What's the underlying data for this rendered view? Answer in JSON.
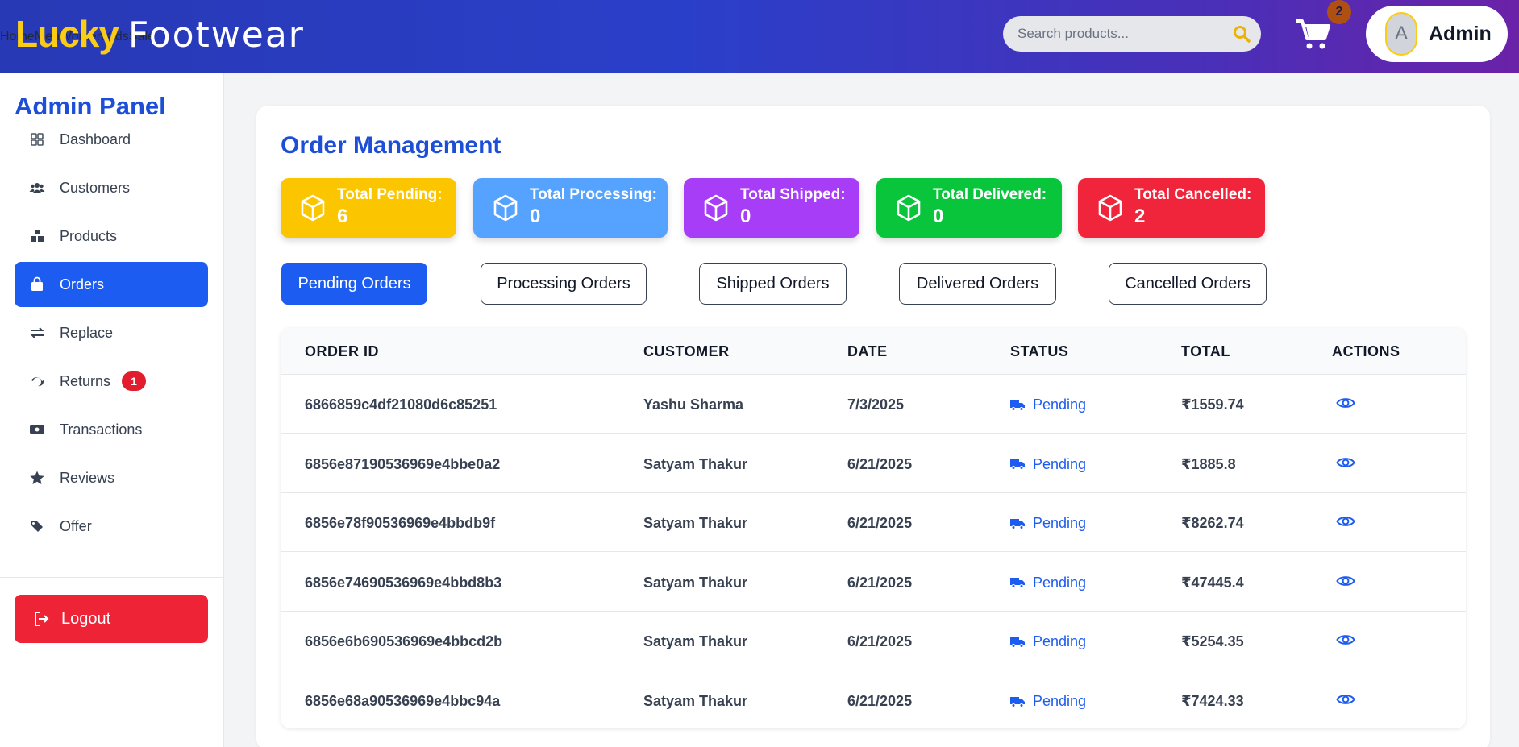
{
  "header": {
    "brand_part1": "Lucky",
    "brand_part2": "Footwear",
    "nav": [
      "Home",
      "Men",
      "Women",
      "Kids",
      "Sale"
    ],
    "search_placeholder": "Search products...",
    "cart_count": "2",
    "avatar_letter": "A",
    "user_name": "Admin"
  },
  "sidebar": {
    "title": "Admin Panel",
    "items": [
      {
        "label": "Dashboard",
        "icon": "dashboard-icon"
      },
      {
        "label": "Customers",
        "icon": "users-icon"
      },
      {
        "label": "Products",
        "icon": "boxes-icon"
      },
      {
        "label": "Orders",
        "icon": "bag-icon"
      },
      {
        "label": "Replace",
        "icon": "swap-icon"
      },
      {
        "label": "Returns",
        "icon": "return-icon",
        "badge": "1"
      },
      {
        "label": "Transactions",
        "icon": "money-icon"
      },
      {
        "label": "Reviews",
        "icon": "star-icon"
      },
      {
        "label": "Offer",
        "icon": "tags-icon"
      }
    ],
    "active": "Orders",
    "logout_label": "Logout"
  },
  "main": {
    "title": "Order Management",
    "stats": [
      {
        "label": "Total Pending:",
        "value": "6",
        "color": "#fbc500"
      },
      {
        "label": "Total Processing:",
        "value": "0",
        "color": "#55a3ff"
      },
      {
        "label": "Total Shipped:",
        "value": "0",
        "color": "#a83df7"
      },
      {
        "label": "Total Delivered:",
        "value": "0",
        "color": "#08c53b"
      },
      {
        "label": "Total Cancelled:",
        "value": "2",
        "color": "#f0243a"
      }
    ],
    "tabs": [
      "Pending Orders",
      "Processing Orders",
      "Shipped Orders",
      "Delivered Orders",
      "Cancelled Orders"
    ],
    "active_tab": "Pending Orders",
    "table": {
      "columns": [
        "ORDER ID",
        "CUSTOMER",
        "DATE",
        "STATUS",
        "TOTAL",
        "ACTIONS"
      ],
      "rows": [
        {
          "id": "6866859c4df21080d6c85251",
          "customer": "Yashu Sharma",
          "date": "7/3/2025",
          "status": "Pending",
          "total": "₹1559.74"
        },
        {
          "id": "6856e87190536969e4bbe0a2",
          "customer": "Satyam Thakur",
          "date": "6/21/2025",
          "status": "Pending",
          "total": "₹1885.8"
        },
        {
          "id": "6856e78f90536969e4bbdb9f",
          "customer": "Satyam Thakur",
          "date": "6/21/2025",
          "status": "Pending",
          "total": "₹8262.74"
        },
        {
          "id": "6856e74690536969e4bbd8b3",
          "customer": "Satyam Thakur",
          "date": "6/21/2025",
          "status": "Pending",
          "total": "₹47445.4"
        },
        {
          "id": "6856e6b690536969e4bbcd2b",
          "customer": "Satyam Thakur",
          "date": "6/21/2025",
          "status": "Pending",
          "total": "₹5254.35"
        },
        {
          "id": "6856e68a90536969e4bbc94a",
          "customer": "Satyam Thakur",
          "date": "6/21/2025",
          "status": "Pending",
          "total": "₹7424.33"
        }
      ]
    }
  }
}
